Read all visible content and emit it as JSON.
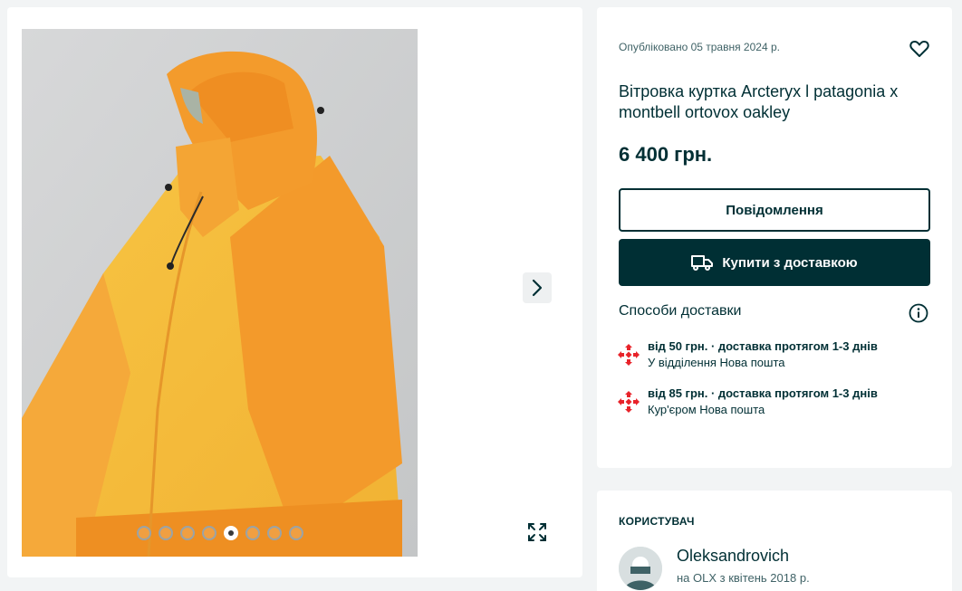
{
  "listing": {
    "published": "Опубліковано 05 травня 2024 р.",
    "title": "Вітровка куртка Arcteryx l patagonia x montbell ortovox oakley",
    "price": "6 400 грн."
  },
  "gallery": {
    "image_count": 8,
    "active_index": 4
  },
  "actions": {
    "message_label": "Повідомлення",
    "buy_label": "Купити з доставкою"
  },
  "delivery": {
    "heading": "Способи доставки",
    "options": [
      {
        "line1": "від 50 грн. · доставка протягом 1-3 днів",
        "line2": "У відділення Нова пошта"
      },
      {
        "line1": "від 85 грн. · доставка протягом 1-3 днів",
        "line2": "Кур'єром Нова пошта"
      }
    ]
  },
  "user": {
    "heading": "КОРИСТУВАЧ",
    "name": "Oleksandrovich",
    "since": "на OLX з квітень 2018 р."
  },
  "colors": {
    "primary": "#002f34",
    "nova_poshta": "#e8232a",
    "jacket_orange": "#f29a2e",
    "jacket_yellow": "#f6bf3e",
    "background": "#f2f4f5"
  },
  "icons": [
    "chevron-right-icon",
    "expand-icon",
    "heart-icon",
    "truck-icon",
    "info-icon",
    "nova-poshta-icon"
  ]
}
